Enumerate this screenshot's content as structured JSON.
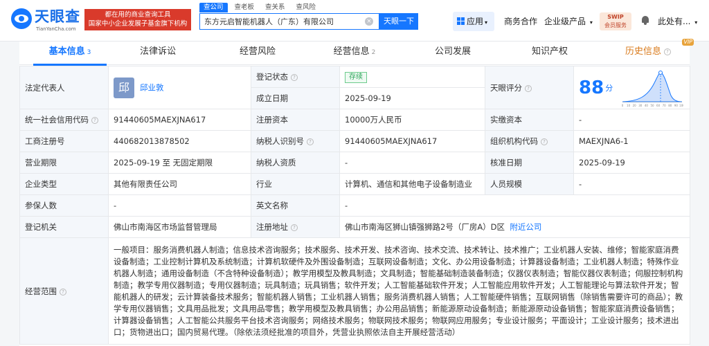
{
  "header": {
    "logo_name": "天眼查",
    "logo_domain": "TianYanCha.com",
    "banner_line1": "都在用的商业查询工具",
    "banner_line2": "国家中小企业发展子基金旗下机构",
    "search_tabs": [
      "查公司",
      "查老板",
      "查关系",
      "查风险"
    ],
    "search_value": "东方元启智能机器人（广东）有限公司",
    "search_button": "天眼一下",
    "nav_apps": "应用",
    "nav_business": "商务合作",
    "nav_enterprise": "企业级产品",
    "svip_line1": "SWIP",
    "svip_line2": "会员服务",
    "user_name": "此处有..."
  },
  "tabs": [
    {
      "label": "基本信息",
      "count": "3"
    },
    {
      "label": "法律诉讼",
      "count": ""
    },
    {
      "label": "经营风险",
      "count": ""
    },
    {
      "label": "经营信息",
      "count": "2"
    },
    {
      "label": "公司发展",
      "count": ""
    },
    {
      "label": "知识产权",
      "count": ""
    },
    {
      "label": "历史信息",
      "count": "",
      "tag": "VIP"
    }
  ],
  "info": {
    "legal_rep_label": "法定代表人",
    "legal_rep_avatar": "邱",
    "legal_rep_name": "邱业敦",
    "reg_status_label": "登记状态",
    "reg_status_value": "存续",
    "found_date_label": "成立日期",
    "found_date_value": "2025-09-19",
    "score_label": "天眼评分",
    "score_value": "88",
    "score_unit": "分",
    "score_axis": [
      "0",
      "10",
      "20",
      "30",
      "40",
      "50",
      "60",
      "70",
      "80",
      "90",
      "100"
    ],
    "credit_code_label": "统一社会信用代码",
    "credit_code_value": "91440605MAEXJNA617",
    "reg_capital_label": "注册资本",
    "reg_capital_value": "10000万人民币",
    "paid_capital_label": "实缴资本",
    "paid_capital_value": "-",
    "biz_reg_no_label": "工商注册号",
    "biz_reg_no_value": "440682013878502",
    "taxpayer_id_label": "纳税人识别号",
    "taxpayer_id_value": "91440605MAEXJNA617",
    "org_code_label": "组织机构代码",
    "org_code_value": "MAEXJNA6-1",
    "term_label": "营业期限",
    "term_value": "2025-09-19 至 无固定期限",
    "taxpayer_qual_label": "纳税人资质",
    "taxpayer_qual_value": "-",
    "approval_date_label": "核准日期",
    "approval_date_value": "2025-09-19",
    "company_type_label": "企业类型",
    "company_type_value": "其他有限责任公司",
    "industry_label": "行业",
    "industry_value": "计算机、通信和其他电子设备制造业",
    "staff_size_label": "人员规模",
    "staff_size_value": "-",
    "insured_label": "参保人数",
    "insured_value": "-",
    "english_name_label": "英文名称",
    "english_name_value": "-",
    "reg_authority_label": "登记机关",
    "reg_authority_value": "佛山市南海区市场监督管理局",
    "reg_address_label": "注册地址",
    "reg_address_value": "佛山市南海区狮山镇强狮路2号（厂房A）D区",
    "nearby_link": "附近公司",
    "scope_label": "经营范围",
    "scope_value": "一般项目：服务消费机器人制造；信息技术咨询服务；技术服务、技术开发、技术咨询、技术交流、技术转让、技术推广；工业机器人安装、维修；智能家庭消费设备制造；工业控制计算机及系统制造；计算机软硬件及外围设备制造；互联网设备制造；文化、办公用设备制造；计算器设备制造；工业机器人制造；特殊作业机器人制造；通用设备制造（不含特种设备制造）；教学用模型及教具制造；文具制造；智能基础制造装备制造；仪器仪表制造；智能仪器仪表制造；伺服控制机构制造；教学专用仪器制造；专用仪器制造；玩具制造；玩具销售；软件开发；人工智能基础软件开发；人工智能应用软件开发；人工智能理论与算法软件开发；智能机器人的研发；云计算装备技术服务；智能机器人销售；工业机器人销售；服务消费机器人销售；人工智能硬件销售；互联网销售（除销售需要许可的商品）；教学专用仪器销售；文具用品批发；文具用品零售；教学用模型及教具销售；办公用品销售；新能源原动设备制造；新能源原动设备销售；智能家庭消费设备销售；计算器设备销售；人工智能公共服务平台技术咨询服务；网络技术服务；物联网技术服务；物联网应用服务；专业设计服务；平面设计；工业设计服务；技术进出口；货物进出口；国内贸易代理。（除依法须经批准的项目外，凭营业执照依法自主开展经营活动）"
  },
  "colors": {
    "brand": "#1677ff",
    "banner": "#d93a2b",
    "status_green": "#2ea55b",
    "history_orange": "#d97a1b"
  }
}
